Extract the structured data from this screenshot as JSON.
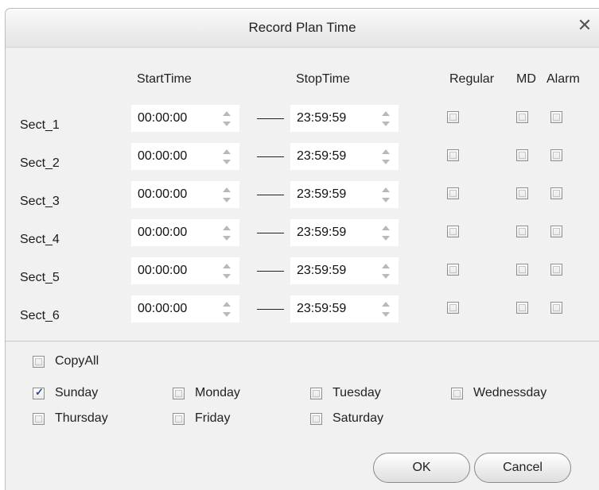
{
  "dialog": {
    "title": "Record Plan Time",
    "close_icon": "close-icon"
  },
  "headers": {
    "start_time": "StartTime",
    "stop_time": "StopTime",
    "regular": "Regular",
    "md": "MD",
    "alarm": "Alarm"
  },
  "sections": [
    {
      "label": "Sect_1",
      "start": "00:00:00",
      "stop": "23:59:59",
      "regular": false,
      "md": false,
      "alarm": false
    },
    {
      "label": "Sect_2",
      "start": "00:00:00",
      "stop": "23:59:59",
      "regular": false,
      "md": false,
      "alarm": false
    },
    {
      "label": "Sect_3",
      "start": "00:00:00",
      "stop": "23:59:59",
      "regular": false,
      "md": false,
      "alarm": false
    },
    {
      "label": "Sect_4",
      "start": "00:00:00",
      "stop": "23:59:59",
      "regular": false,
      "md": false,
      "alarm": false
    },
    {
      "label": "Sect_5",
      "start": "00:00:00",
      "stop": "23:59:59",
      "regular": false,
      "md": false,
      "alarm": false
    },
    {
      "label": "Sect_6",
      "start": "00:00:00",
      "stop": "23:59:59",
      "regular": false,
      "md": false,
      "alarm": false
    }
  ],
  "copy_all": {
    "label": "CopyAll",
    "checked": false
  },
  "days": [
    {
      "label": "Sunday",
      "checked": true
    },
    {
      "label": "Monday",
      "checked": false
    },
    {
      "label": "Tuesday",
      "checked": false
    },
    {
      "label": "Wednessday",
      "checked": false
    },
    {
      "label": "Thursday",
      "checked": false
    },
    {
      "label": "Friday",
      "checked": false
    },
    {
      "label": "Saturday",
      "checked": false
    }
  ],
  "buttons": {
    "ok": "OK",
    "cancel": "Cancel"
  },
  "colors": {
    "dialog_bg": "#f1f1f1",
    "check_mark": "#2a4f8f"
  }
}
